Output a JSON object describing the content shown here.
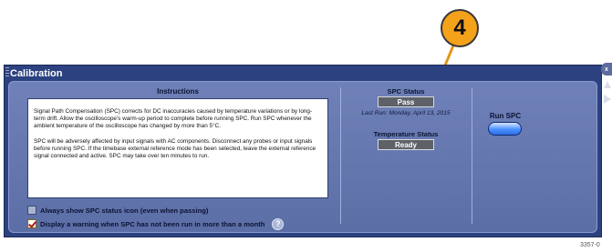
{
  "callout": {
    "number": "4"
  },
  "window": {
    "title": "Calibration",
    "close_label": "x"
  },
  "instructions": {
    "heading": "Instructions",
    "paragraph1": "Signal Path Compensation (SPC) corrects for DC inaccuracies caused by temperature variations or by long-term drift. Allow the oscilloscope's warm-up period to complete before running SPC. Run SPC whenever the ambient temperature of the oscilloscope has changed by more than 5°C.",
    "paragraph2": "SPC will be adversely affected by input signals with AC components. Disconnect any probes or input signals before running SPC. If the timebase external reference mode has been selected, leave the external reference signal connected and active. SPC may take over ten minutes to run."
  },
  "options": {
    "always_show": {
      "label": "Always show SPC status icon (even when passing)",
      "checked": false
    },
    "display_warning": {
      "label": "Display a warning when SPC has not been run in more than a month",
      "checked": true
    }
  },
  "status": {
    "spc_label": "SPC Status",
    "spc_value": "Pass",
    "last_run": "Last Run: Monday, April 13, 2015",
    "temp_label": "Temperature Status",
    "temp_value": "Ready"
  },
  "actions": {
    "run_spc_label": "Run SPC"
  },
  "figure_code": "3357-0",
  "colors": {
    "callout_fill": "#f5a21b",
    "window_frame": "#2c4280",
    "panel": "#6f81b8",
    "status_pill": "#5e6168",
    "run_button": "#4a90ff"
  }
}
